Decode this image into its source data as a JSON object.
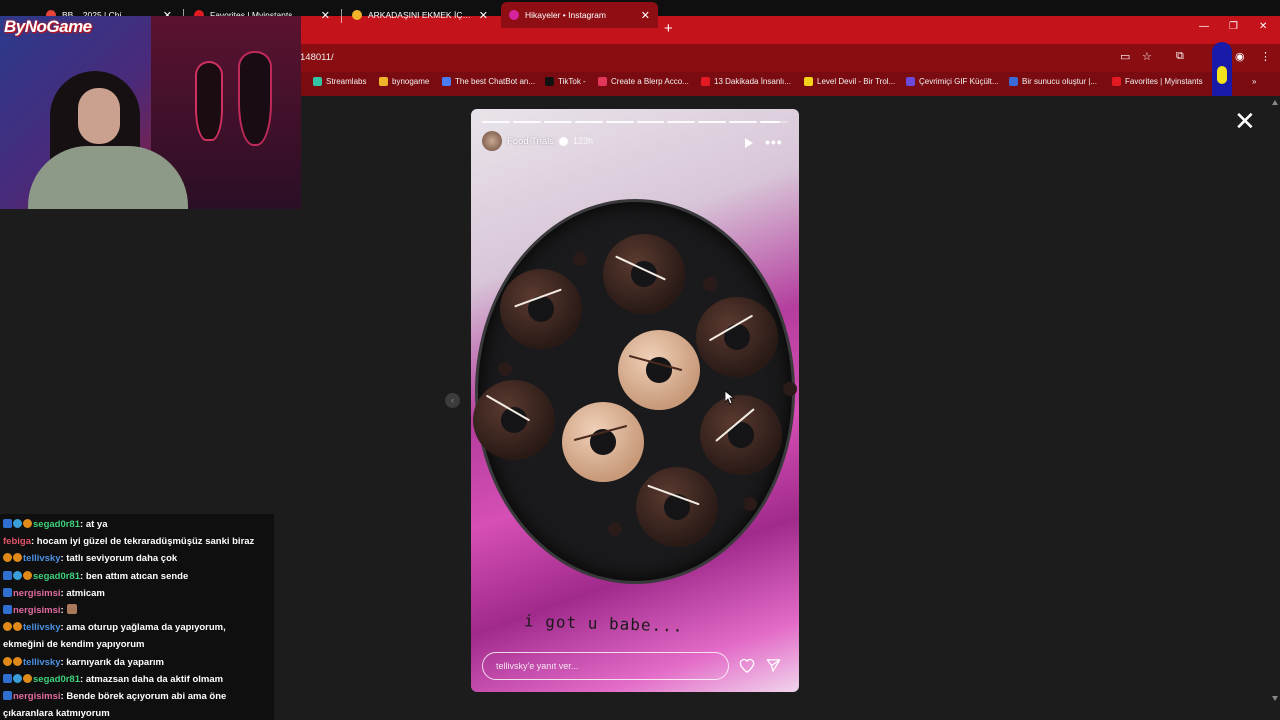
{
  "browser": {
    "tabs": [
      {
        "label": "BB... 2025 | Chi",
        "color": "#e8443a"
      },
      {
        "label": "Favorites | Myinstants",
        "color": "#e21b23"
      },
      {
        "label": "ARKADAŞINI EKMEK İÇİN BAHAR",
        "color": "#f0b42a"
      },
      {
        "label": "Hikayeler • Instagram",
        "color": "#d6249f"
      }
    ],
    "new_tab": "+",
    "url": "148011/",
    "window_controls": {
      "minimize": "—",
      "restore": "❐",
      "close": "✕"
    },
    "bookmarks": [
      {
        "label": "Streamlabs",
        "color": "#31c3a2"
      },
      {
        "label": "bynogame",
        "color": "#f0b42a"
      },
      {
        "label": "The best ChatBot an...",
        "color": "#4b7cf5"
      },
      {
        "label": "TikTok -",
        "color": "#111111"
      },
      {
        "label": "Create a Blerp Acco...",
        "color": "#e2365a"
      },
      {
        "label": "13 Dakikada İnsanlı...",
        "color": "#e21b23"
      },
      {
        "label": "Level Devil - Bir Trol...",
        "color": "#f4d21b"
      },
      {
        "label": "Çevrimiçi GIF Küçült...",
        "color": "#6a4ad8"
      },
      {
        "label": "Bir sunucu oluştur |...",
        "color": "#3a6ad8"
      },
      {
        "label": "Favorites | Myinstants",
        "color": "#e21b23"
      }
    ],
    "bookmarks_more": "»"
  },
  "overlay": {
    "logo": "ByNoGame"
  },
  "chat": {
    "messages": [
      {
        "user": "segad0r81",
        "color": "#3fd07a",
        "text": ": at ya"
      },
      {
        "user": "febiga",
        "color": "#e0556a",
        "text": ": hocam iyi güzel de tekraradüşmüşüz sanki biraz"
      },
      {
        "user": "tellivsky",
        "color": "#4a90e2",
        "text": ": tatlı seviyorum daha çok"
      },
      {
        "user": "segad0r81",
        "color": "#3fd07a",
        "text": ": ben attım atıcan sende"
      },
      {
        "user": "nergisimsi",
        "color": "#e06aa0",
        "text": ": atmicam"
      },
      {
        "user": "nergisimsi",
        "color": "#e06aa0",
        "text": ":"
      },
      {
        "user": "tellivsky",
        "color": "#4a90e2",
        "text": ": ama oturup yağlama da yapıyorum,"
      },
      {
        "user": "",
        "color": "#ffffff",
        "text": "ekmeğini de kendim yapıyorum"
      },
      {
        "user": "tellivsky",
        "color": "#4a90e2",
        "text": ": karnıyarık da yaparım"
      },
      {
        "user": "segad0r81",
        "color": "#3fd07a",
        "text": ": atmazsan daha da aktif olmam"
      },
      {
        "user": "nergisimsi",
        "color": "#e06aa0",
        "text": ": Bende börek açıyorum abi ama öne"
      },
      {
        "user": "",
        "color": "#ffffff",
        "text": "çıkaranlara katmıyorum"
      }
    ]
  },
  "story": {
    "username": "Food Trials",
    "time": "123h",
    "caption": "i got u babe...",
    "reply_placeholder": "tellivsky'e yanıt ver...",
    "progress_segments": 10,
    "progress_current": 10,
    "progress_current_fill": 0.7
  },
  "icons": {
    "close": "✕",
    "prev": "‹",
    "more": "•••",
    "play": "play-icon",
    "heart": "heart-icon",
    "send": "send-icon"
  }
}
